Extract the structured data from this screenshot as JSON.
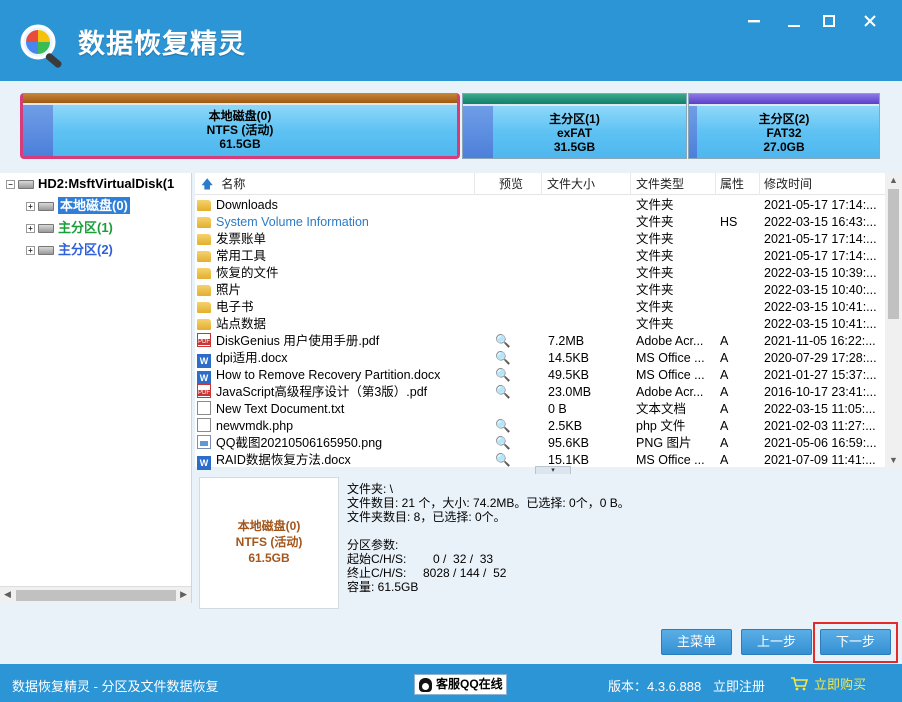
{
  "window": {
    "title": "数据恢复精灵",
    "min_glyph": "—",
    "restore_glyph": "▭",
    "max_glyph": "□",
    "close_glyph": "✕"
  },
  "partitions": [
    {
      "name": "本地磁盘(0)",
      "fs": "NTFS (活动)",
      "size": "61.5GB",
      "selected": true
    },
    {
      "name": "主分区(1)",
      "fs": "exFAT",
      "size": "31.5GB",
      "selected": false
    },
    {
      "name": "主分区(2)",
      "fs": "FAT32",
      "size": "27.0GB",
      "selected": false
    }
  ],
  "tree": {
    "root": "HD2:MsftVirtualDisk(1",
    "children": [
      "本地磁盘(0)",
      "主分区(1)",
      "主分区(2)"
    ],
    "expand_glyph": "+",
    "collapse_glyph": "−"
  },
  "list": {
    "up_glyph": "🡅",
    "headers": {
      "name": "名称",
      "preview": "预览",
      "size": "文件大小",
      "type": "文件类型",
      "attr": "属性",
      "time": "修改时间"
    },
    "rows": [
      {
        "icon": "folder-icon",
        "name": "Downloads",
        "preview": "",
        "size": "",
        "type": "文件夹",
        "attr": "",
        "time": "2021-05-17 17:14:..."
      },
      {
        "icon": "folder-icon",
        "name": "System Volume Information",
        "preview": "",
        "size": "",
        "type": "文件夹",
        "attr": "HS",
        "time": "2022-03-15 16:43:..."
      },
      {
        "icon": "folder-icon",
        "name": "发票账单",
        "preview": "",
        "size": "",
        "type": "文件夹",
        "attr": "",
        "time": "2021-05-17 17:14:..."
      },
      {
        "icon": "folder-icon",
        "name": "常用工具",
        "preview": "",
        "size": "",
        "type": "文件夹",
        "attr": "",
        "time": "2021-05-17 17:14:..."
      },
      {
        "icon": "folder-icon",
        "name": "恢复的文件",
        "preview": "",
        "size": "",
        "type": "文件夹",
        "attr": "",
        "time": "2022-03-15 10:39:..."
      },
      {
        "icon": "folder-icon",
        "name": "照片",
        "preview": "",
        "size": "",
        "type": "文件夹",
        "attr": "",
        "time": "2022-03-15 10:40:..."
      },
      {
        "icon": "folder-icon",
        "name": "电子书",
        "preview": "",
        "size": "",
        "type": "文件夹",
        "attr": "",
        "time": "2022-03-15 10:41:..."
      },
      {
        "icon": "folder-icon",
        "name": "站点数据",
        "preview": "",
        "size": "",
        "type": "文件夹",
        "attr": "",
        "time": "2022-03-15 10:41:..."
      },
      {
        "icon": "pdf-icon",
        "name": "DiskGenius 用户使用手册.pdf",
        "preview": "🔍",
        "size": "7.2MB",
        "type": "Adobe Acr...",
        "attr": "A",
        "time": "2021-11-05 16:22:..."
      },
      {
        "icon": "word-icon",
        "name": "dpi适用.docx",
        "preview": "🔍",
        "size": "14.5KB",
        "type": "MS Office ...",
        "attr": "A",
        "time": "2020-07-29 17:28:..."
      },
      {
        "icon": "word-icon",
        "name": "How to Remove Recovery Partition.docx",
        "preview": "🔍",
        "size": "49.5KB",
        "type": "MS Office ...",
        "attr": "A",
        "time": "2021-01-27 15:37:..."
      },
      {
        "icon": "pdf-icon",
        "name": "JavaScript高级程序设计（第3版）.pdf",
        "preview": "🔍",
        "size": "23.0MB",
        "type": "Adobe Acr...",
        "attr": "A",
        "time": "2016-10-17 23:41:..."
      },
      {
        "icon": "doc-icon",
        "name": "New Text Document.txt",
        "preview": "",
        "size": "0 B",
        "type": "文本文档",
        "attr": "A",
        "time": "2022-03-15 11:05:..."
      },
      {
        "icon": "doc-icon",
        "name": "newvmdk.php",
        "preview": "🔍",
        "size": "2.5KB",
        "type": "php 文件",
        "attr": "A",
        "time": "2021-02-03 11:27:..."
      },
      {
        "icon": "image-icon",
        "name": "QQ截图20210506165950.png",
        "preview": "🔍",
        "size": "95.6KB",
        "type": "PNG 图片",
        "attr": "A",
        "time": "2021-05-06 16:59:..."
      },
      {
        "icon": "word-icon",
        "name": "RAID数据恢复方法.docx",
        "preview": "🔍",
        "size": "15.1KB",
        "type": "MS Office ...",
        "attr": "A",
        "time": "2021-07-09 11:41:..."
      }
    ]
  },
  "info": {
    "name": "本地磁盘(0)",
    "fs": "NTFS (活动)",
    "size": "61.5GB",
    "text": "文件夹: \\\n文件数目: 21 个，大小: 74.2MB。已选择: 0个，0 B。\n文件夹数目: 8，已选择: 0个。\n\n分区参数:\n起始C/H/S:        0 /  32 /  33\n终止C/H/S:     8028 / 144 /  52\n容量: 61.5GB"
  },
  "buttons": {
    "main_menu": "主菜单",
    "prev": "上一步",
    "next": "下一步"
  },
  "footer": {
    "left": "数据恢复精灵 - 分区及文件数据恢复",
    "qq": "客服QQ在线",
    "version": "版本：4.3.6.888",
    "register": "立即注册",
    "buy": "立即购买"
  },
  "colors": {
    "accent": "#2b95d6",
    "selection_outline": "#d63c7a",
    "next_outline": "#e22c2c",
    "buy": "#f6e74b"
  }
}
